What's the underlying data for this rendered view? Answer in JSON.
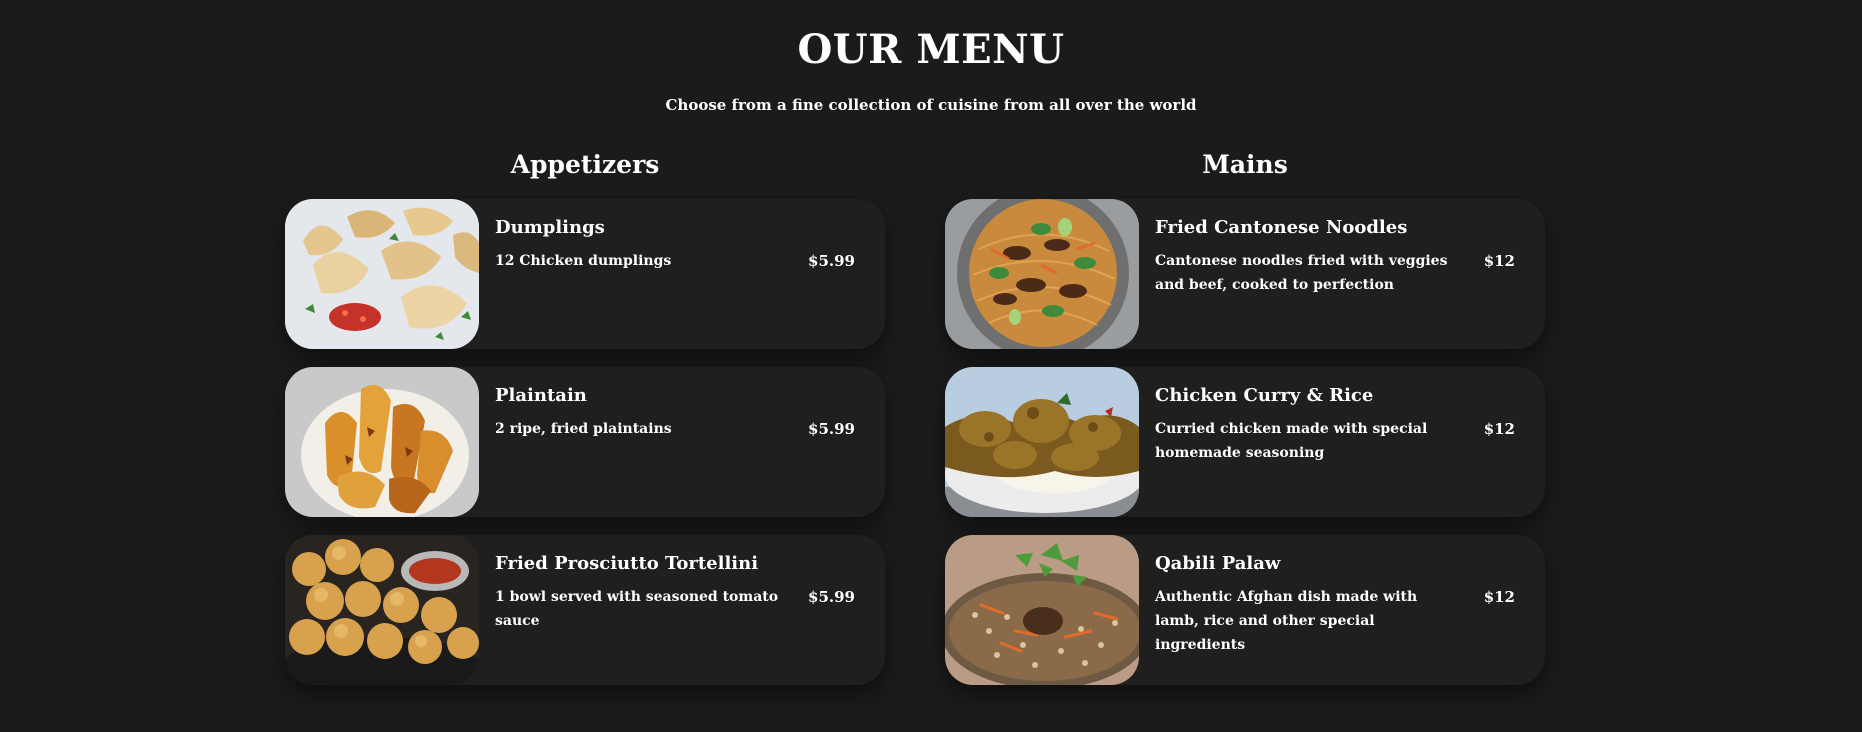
{
  "header": {
    "title": "OUR MENU",
    "subtitle": "Choose from a fine collection of cuisine from all over the world"
  },
  "sections": [
    {
      "title": "Appetizers",
      "items": [
        {
          "name": "Dumplings",
          "description": "12 Chicken dumplings",
          "price": "$5.99",
          "image_alt": "dumplings-photo"
        },
        {
          "name": "Plaintain",
          "description": "2 ripe, fried plaintains",
          "price": "$5.99",
          "image_alt": "plantains-photo"
        },
        {
          "name": "Fried Prosciutto Tortellini",
          "description": "1 bowl served with seasoned tomato sauce",
          "price": "$5.99",
          "image_alt": "tortellini-photo"
        }
      ]
    },
    {
      "title": "Mains",
      "items": [
        {
          "name": "Fried Cantonese Noodles",
          "description": "Cantonese noodles fried with veggies and beef, cooked to perfection",
          "price": "$12",
          "image_alt": "noodles-photo"
        },
        {
          "name": "Chicken Curry & Rice",
          "description": "Curried chicken made with special homemade seasoning",
          "price": "$12",
          "image_alt": "curry-photo"
        },
        {
          "name": "Qabili Palaw",
          "description": "Authentic Afghan dish made with lamb, rice and other special ingredients",
          "price": "$12",
          "image_alt": "palaw-photo"
        }
      ]
    }
  ],
  "colors": {
    "background": "#1b1b1b",
    "card": "#1f1f1f",
    "text": "#ffffff"
  }
}
